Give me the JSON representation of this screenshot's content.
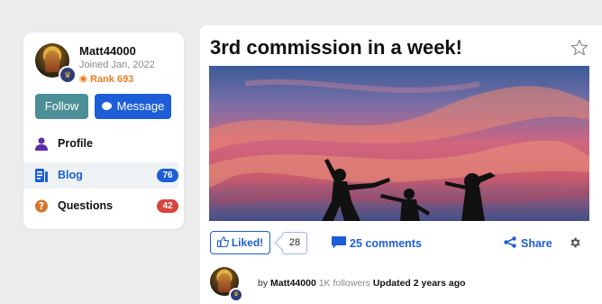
{
  "profile": {
    "username": "Matt44000",
    "joined": "Joined Jan, 2022",
    "rank": "Rank 693",
    "follow_label": "Follow",
    "message_label": "Message"
  },
  "nav": {
    "items": [
      {
        "label": "Profile",
        "icon": "user-icon"
      },
      {
        "label": "Blog",
        "icon": "blog-icon",
        "count": "76",
        "count_color": "#1d5ed8",
        "active": true
      },
      {
        "label": "Questions",
        "icon": "question-icon",
        "count": "42",
        "count_color": "#d9453d"
      }
    ]
  },
  "post": {
    "title": "3rd commission in a week!",
    "liked_label": "Liked!",
    "like_count": "28",
    "comments_label": "25 comments",
    "share_label": "Share",
    "author_prefix": "by",
    "author": "Matt44000",
    "followers": "1K followers",
    "updated": "Updated 2 years ago"
  },
  "colors": {
    "accent": "#1d5ed8",
    "follow": "#4d8f96",
    "rank": "#e67e22",
    "questions_badge": "#d9453d"
  }
}
